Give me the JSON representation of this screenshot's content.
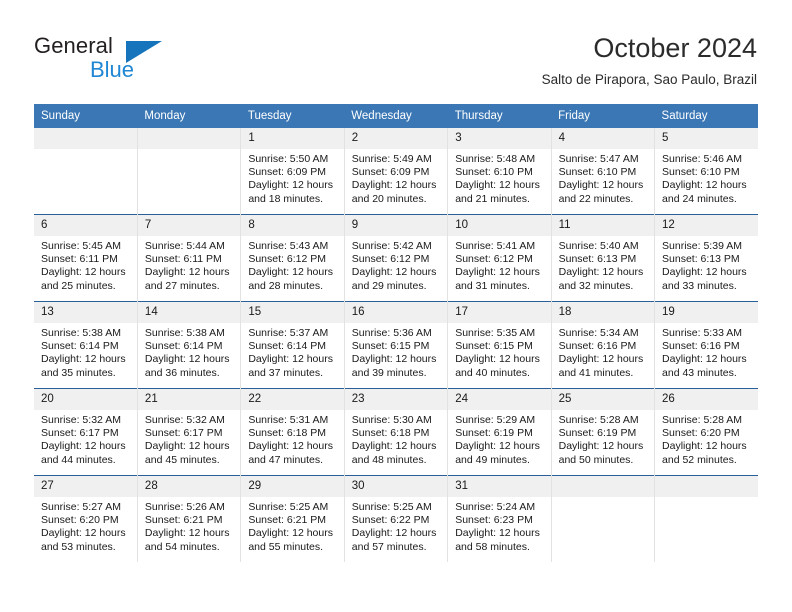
{
  "brand": {
    "name_top": "General",
    "name_bottom": "Blue",
    "triangle_color": "#1574bb",
    "blue_text_color": "#1f87d4"
  },
  "header": {
    "title": "October 2024",
    "subtitle": "Salto de Pirapora, Sao Paulo, Brazil"
  },
  "theme": {
    "header_row_bg": "#3b77b5",
    "week_divider": "#2a6099",
    "daynum_bg": "#f0f0f0"
  },
  "calendar": {
    "weekday_headers": [
      "Sunday",
      "Monday",
      "Tuesday",
      "Wednesday",
      "Thursday",
      "Friday",
      "Saturday"
    ],
    "weeks": [
      [
        {
          "day": "",
          "lines": []
        },
        {
          "day": "",
          "lines": []
        },
        {
          "day": "1",
          "lines": [
            "Sunrise: 5:50 AM",
            "Sunset: 6:09 PM",
            "Daylight: 12 hours",
            "and 18 minutes."
          ]
        },
        {
          "day": "2",
          "lines": [
            "Sunrise: 5:49 AM",
            "Sunset: 6:09 PM",
            "Daylight: 12 hours",
            "and 20 minutes."
          ]
        },
        {
          "day": "3",
          "lines": [
            "Sunrise: 5:48 AM",
            "Sunset: 6:10 PM",
            "Daylight: 12 hours",
            "and 21 minutes."
          ]
        },
        {
          "day": "4",
          "lines": [
            "Sunrise: 5:47 AM",
            "Sunset: 6:10 PM",
            "Daylight: 12 hours",
            "and 22 minutes."
          ]
        },
        {
          "day": "5",
          "lines": [
            "Sunrise: 5:46 AM",
            "Sunset: 6:10 PM",
            "Daylight: 12 hours",
            "and 24 minutes."
          ]
        }
      ],
      [
        {
          "day": "6",
          "lines": [
            "Sunrise: 5:45 AM",
            "Sunset: 6:11 PM",
            "Daylight: 12 hours",
            "and 25 minutes."
          ]
        },
        {
          "day": "7",
          "lines": [
            "Sunrise: 5:44 AM",
            "Sunset: 6:11 PM",
            "Daylight: 12 hours",
            "and 27 minutes."
          ]
        },
        {
          "day": "8",
          "lines": [
            "Sunrise: 5:43 AM",
            "Sunset: 6:12 PM",
            "Daylight: 12 hours",
            "and 28 minutes."
          ]
        },
        {
          "day": "9",
          "lines": [
            "Sunrise: 5:42 AM",
            "Sunset: 6:12 PM",
            "Daylight: 12 hours",
            "and 29 minutes."
          ]
        },
        {
          "day": "10",
          "lines": [
            "Sunrise: 5:41 AM",
            "Sunset: 6:12 PM",
            "Daylight: 12 hours",
            "and 31 minutes."
          ]
        },
        {
          "day": "11",
          "lines": [
            "Sunrise: 5:40 AM",
            "Sunset: 6:13 PM",
            "Daylight: 12 hours",
            "and 32 minutes."
          ]
        },
        {
          "day": "12",
          "lines": [
            "Sunrise: 5:39 AM",
            "Sunset: 6:13 PM",
            "Daylight: 12 hours",
            "and 33 minutes."
          ]
        }
      ],
      [
        {
          "day": "13",
          "lines": [
            "Sunrise: 5:38 AM",
            "Sunset: 6:14 PM",
            "Daylight: 12 hours",
            "and 35 minutes."
          ]
        },
        {
          "day": "14",
          "lines": [
            "Sunrise: 5:38 AM",
            "Sunset: 6:14 PM",
            "Daylight: 12 hours",
            "and 36 minutes."
          ]
        },
        {
          "day": "15",
          "lines": [
            "Sunrise: 5:37 AM",
            "Sunset: 6:14 PM",
            "Daylight: 12 hours",
            "and 37 minutes."
          ]
        },
        {
          "day": "16",
          "lines": [
            "Sunrise: 5:36 AM",
            "Sunset: 6:15 PM",
            "Daylight: 12 hours",
            "and 39 minutes."
          ]
        },
        {
          "day": "17",
          "lines": [
            "Sunrise: 5:35 AM",
            "Sunset: 6:15 PM",
            "Daylight: 12 hours",
            "and 40 minutes."
          ]
        },
        {
          "day": "18",
          "lines": [
            "Sunrise: 5:34 AM",
            "Sunset: 6:16 PM",
            "Daylight: 12 hours",
            "and 41 minutes."
          ]
        },
        {
          "day": "19",
          "lines": [
            "Sunrise: 5:33 AM",
            "Sunset: 6:16 PM",
            "Daylight: 12 hours",
            "and 43 minutes."
          ]
        }
      ],
      [
        {
          "day": "20",
          "lines": [
            "Sunrise: 5:32 AM",
            "Sunset: 6:17 PM",
            "Daylight: 12 hours",
            "and 44 minutes."
          ]
        },
        {
          "day": "21",
          "lines": [
            "Sunrise: 5:32 AM",
            "Sunset: 6:17 PM",
            "Daylight: 12 hours",
            "and 45 minutes."
          ]
        },
        {
          "day": "22",
          "lines": [
            "Sunrise: 5:31 AM",
            "Sunset: 6:18 PM",
            "Daylight: 12 hours",
            "and 47 minutes."
          ]
        },
        {
          "day": "23",
          "lines": [
            "Sunrise: 5:30 AM",
            "Sunset: 6:18 PM",
            "Daylight: 12 hours",
            "and 48 minutes."
          ]
        },
        {
          "day": "24",
          "lines": [
            "Sunrise: 5:29 AM",
            "Sunset: 6:19 PM",
            "Daylight: 12 hours",
            "and 49 minutes."
          ]
        },
        {
          "day": "25",
          "lines": [
            "Sunrise: 5:28 AM",
            "Sunset: 6:19 PM",
            "Daylight: 12 hours",
            "and 50 minutes."
          ]
        },
        {
          "day": "26",
          "lines": [
            "Sunrise: 5:28 AM",
            "Sunset: 6:20 PM",
            "Daylight: 12 hours",
            "and 52 minutes."
          ]
        }
      ],
      [
        {
          "day": "27",
          "lines": [
            "Sunrise: 5:27 AM",
            "Sunset: 6:20 PM",
            "Daylight: 12 hours",
            "and 53 minutes."
          ]
        },
        {
          "day": "28",
          "lines": [
            "Sunrise: 5:26 AM",
            "Sunset: 6:21 PM",
            "Daylight: 12 hours",
            "and 54 minutes."
          ]
        },
        {
          "day": "29",
          "lines": [
            "Sunrise: 5:25 AM",
            "Sunset: 6:21 PM",
            "Daylight: 12 hours",
            "and 55 minutes."
          ]
        },
        {
          "day": "30",
          "lines": [
            "Sunrise: 5:25 AM",
            "Sunset: 6:22 PM",
            "Daylight: 12 hours",
            "and 57 minutes."
          ]
        },
        {
          "day": "31",
          "lines": [
            "Sunrise: 5:24 AM",
            "Sunset: 6:23 PM",
            "Daylight: 12 hours",
            "and 58 minutes."
          ]
        },
        {
          "day": "",
          "lines": []
        },
        {
          "day": "",
          "lines": []
        }
      ]
    ]
  }
}
